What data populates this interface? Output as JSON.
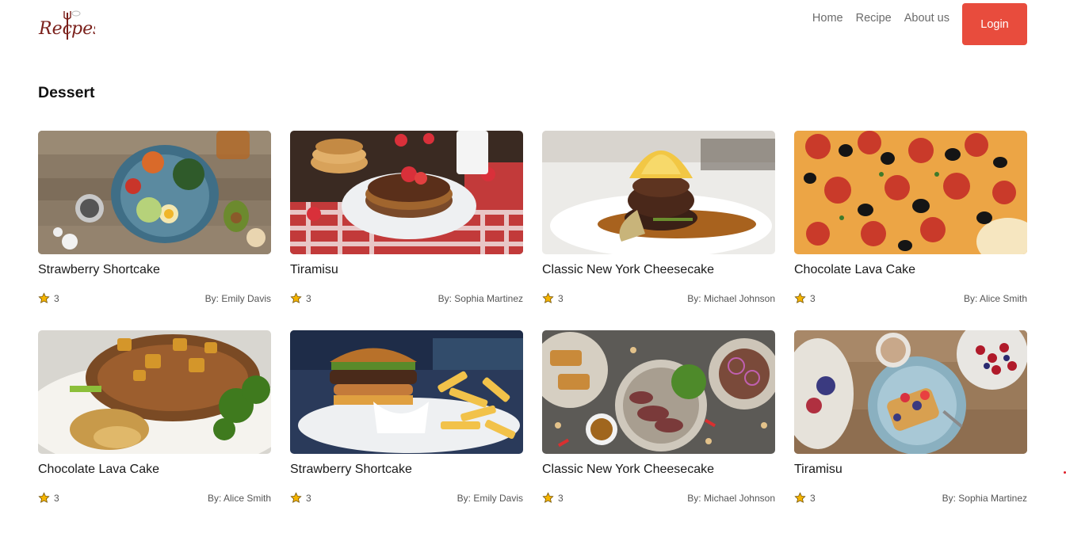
{
  "nav": {
    "logo_text": "Recipes",
    "links": [
      "Home",
      "Recipe",
      "About us"
    ],
    "login_label": "Login"
  },
  "section": {
    "title": "Dessert"
  },
  "cards": [
    {
      "title": "Strawberry Shortcake",
      "rating": "3",
      "author": "By: Emily Davis",
      "image": "salad-bowl"
    },
    {
      "title": "Tiramisu",
      "rating": "3",
      "author": "By: Sophia Martinez",
      "image": "pancakes-strawberries"
    },
    {
      "title": "Classic New York Cheesecake",
      "rating": "3",
      "author": "By: Michael Johnson",
      "image": "steak-tower"
    },
    {
      "title": "Chocolate Lava Cake",
      "rating": "3",
      "author": "By: Alice Smith",
      "image": "pepperoni-pizza"
    },
    {
      "title": "Chocolate Lava Cake",
      "rating": "3",
      "author": "By: Alice Smith",
      "image": "pork-chop-broccoli"
    },
    {
      "title": "Strawberry Shortcake",
      "rating": "3",
      "author": "By: Emily Davis",
      "image": "burger-fries"
    },
    {
      "title": "Classic New York Cheesecake",
      "rating": "3",
      "author": "By: Michael Johnson",
      "image": "steak-salad-plates"
    },
    {
      "title": "Tiramisu",
      "rating": "3",
      "author": "By: Sophia Martinez",
      "image": "berry-french-toast"
    }
  ],
  "colors": {
    "accent": "#e84c3d",
    "star": "#f4b400",
    "link": "#6b6b6b"
  }
}
